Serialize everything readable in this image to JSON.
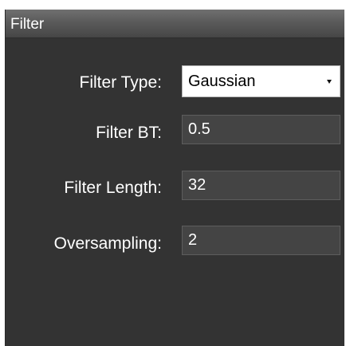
{
  "panel": {
    "title": "Filter"
  },
  "fields": {
    "filter_type": {
      "label": "Filter Type:",
      "value": "Gaussian"
    },
    "filter_bt": {
      "label": "Filter BT:",
      "value": "0.5"
    },
    "filter_length": {
      "label": "Filter Length:",
      "value": "32"
    },
    "oversampling": {
      "label": "Oversampling:",
      "value": "2"
    }
  },
  "icons": {
    "dropdown": "chevron-down-icon"
  }
}
